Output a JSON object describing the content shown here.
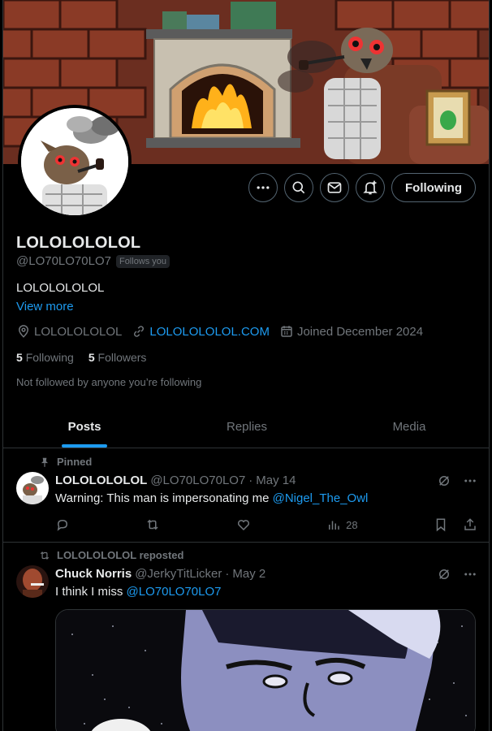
{
  "profile": {
    "name": "LOLOLOLOLOL",
    "handle": "@LO70LO70LO7",
    "follows_you": "Follows you",
    "bio": "LOLOLOLOLOL",
    "view_more": "View more",
    "location": "LOLOLOLOLOL",
    "website": "LOLOLOLOLOL.COM",
    "joined": "Joined December 2024",
    "following_count": "5",
    "following_label": "Following",
    "followers_count": "5",
    "followers_label": "Followers",
    "not_followed": "Not followed by anyone you’re following"
  },
  "actions": {
    "more_icon": "more-icon",
    "search_icon": "search-icon",
    "message_icon": "mail-icon",
    "notify_icon": "bell-plus-icon",
    "following_label": "Following"
  },
  "tabs": [
    {
      "label": "Posts",
      "active": true
    },
    {
      "label": "Replies",
      "active": false
    },
    {
      "label": "Media",
      "active": false
    }
  ],
  "posts": [
    {
      "context": "Pinned",
      "name": "LOLOLOLOLOL",
      "handle": "@LO70LO70LO7",
      "sep": "·",
      "date": "May 14",
      "text": "Warning: This man is impersonating me ",
      "mention": "@Nigel_The_Owl",
      "views": "28"
    },
    {
      "context": "LOLOLOLOLOL reposted",
      "name": "Chuck Norris",
      "handle": "@JerkyTitLicker",
      "sep": "·",
      "date": "May 2",
      "text": "I think I miss ",
      "mention": "@LO70LO70LO7"
    }
  ],
  "colors": {
    "accent": "#1d9bf0",
    "muted": "#71767b",
    "border": "#2f3336",
    "text": "#e7e9ea"
  }
}
